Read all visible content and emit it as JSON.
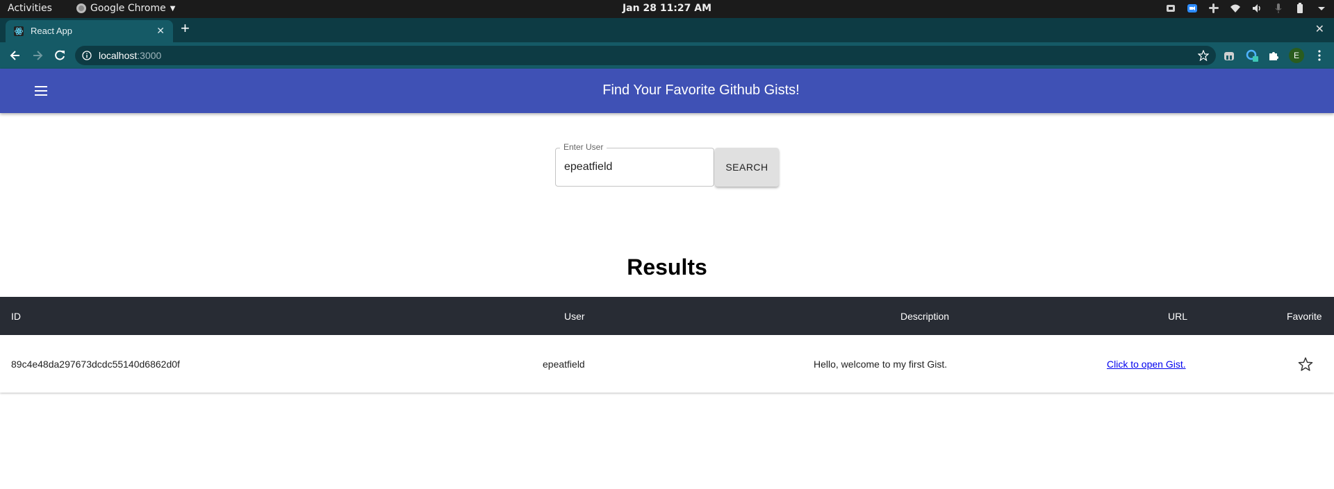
{
  "os_bar": {
    "activities": "Activities",
    "app_name": "Google Chrome",
    "clock": "Jan 28  11:27 AM"
  },
  "browser": {
    "tab_title": "React App",
    "url_host": "localhost",
    "url_port": ":3000",
    "profile_initial": "E"
  },
  "app": {
    "title": "Find Your Favorite Github Gists!",
    "search": {
      "label": "Enter User",
      "value": "epeatfield",
      "button_label": "SEARCH"
    },
    "results_heading": "Results",
    "table": {
      "headers": {
        "id": "ID",
        "user": "User",
        "description": "Description",
        "url": "URL",
        "favorite": "Favorite"
      },
      "rows": [
        {
          "id": "89c4e48da297673dcdc55140d6862d0f",
          "user": "epeatfield",
          "description": "Hello, welcome to my first Gist.",
          "url_text": "Click to open Gist.",
          "favorite": false
        }
      ]
    }
  },
  "colors": {
    "appbar": "#3f51b5",
    "table_header": "#282c34",
    "tab_strip": "#0d3b44",
    "toolbar": "#155a66"
  }
}
